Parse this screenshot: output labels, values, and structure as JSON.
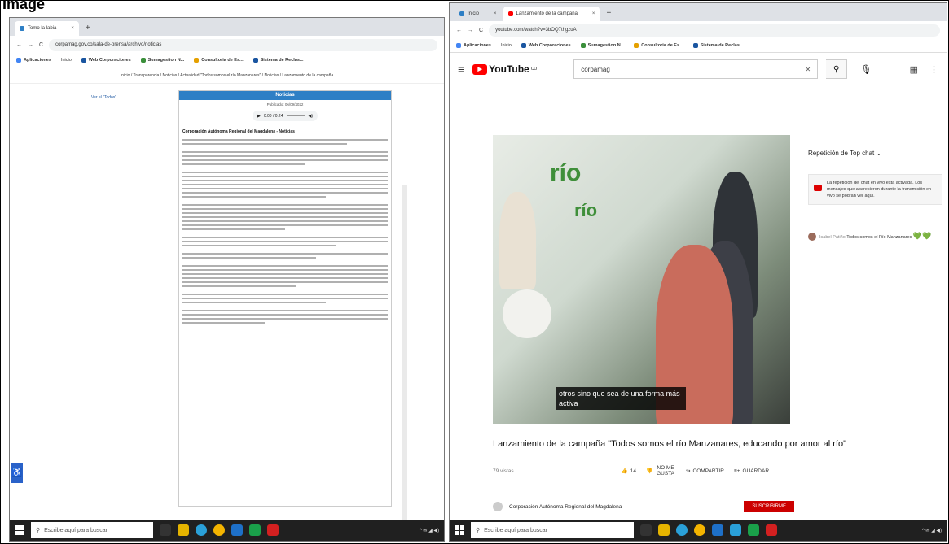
{
  "caption": "Image",
  "left": {
    "tabs": [
      {
        "label": "Tomo la labia",
        "close": "×"
      }
    ],
    "new_tab": "+",
    "url": "corpamag.gov.co/sala-de-prensa/archivo/noticias",
    "bookmarks": [
      "Aplicaciones",
      "Inicio",
      "Web Corporaciones",
      "Sumagestion N...",
      "Consultoria de Es...",
      "Sistema de Reclas..."
    ],
    "breadcrumb": "Inicio / Transparencia / Noticias / Actualidad \"Todos somos el río Manzanares\" / Noticias / Lanzamiento de la campaña",
    "side_link": "Ver el \"Todos\"",
    "article": {
      "header": "Noticias",
      "date": "Publicado: 06/09/2022",
      "player_time": "0:00 / 0:24",
      "title": "Corporación Autónoma Regional del Magdalena - Noticias"
    },
    "accessibility": "♿",
    "taskbar_search": "Escribe aquí para buscar"
  },
  "right": {
    "tabs": [
      {
        "label": "Inicio",
        "close": "×"
      },
      {
        "label": "Lanzamiento de la campaña",
        "close": "×"
      }
    ],
    "new_tab": "+",
    "url": "youtube.com/watch?v=3bOQ7thgzuA",
    "bookmarks": [
      "Aplicaciones",
      "Inicio",
      "Web Corporaciones",
      "Sumagestion N...",
      "Consultoria de Es...",
      "Sistema de Reclas..."
    ],
    "youtube": {
      "logo": "YouTube",
      "country": "CO",
      "search_value": "corpamag",
      "video_caption": "otros sino que sea de una forma más activa",
      "video_title": "Lanzamiento de la campaña \"Todos somos el río Manzanares, educando por amor al río\"",
      "views": "79 vistas",
      "likes": "14",
      "dislike_label": "NO ME GUSTA",
      "share_label": "COMPARTIR",
      "save_label": "GUARDAR",
      "channel": "Corporación Autónoma Regional del Magdalena",
      "subscribe": "SUSCRIBIRME",
      "chat_title": "Repetición de Top chat",
      "chat_note": "La repetición del chat en vivo está activada. Los mensajes que aparecieron durante la transmisión en vivo se podrán ver aquí.",
      "chat_user": "Isabel Patiño",
      "chat_text": "Todos somos el Río Manzanares",
      "chat_hearts": "💚💚"
    },
    "taskbar_search": "Escribe aquí para buscar"
  },
  "video_logo_text": "río",
  "colors": {
    "accent": "#2e7fc5",
    "youtube_red": "#ff0000",
    "taskbar": "#202020"
  }
}
